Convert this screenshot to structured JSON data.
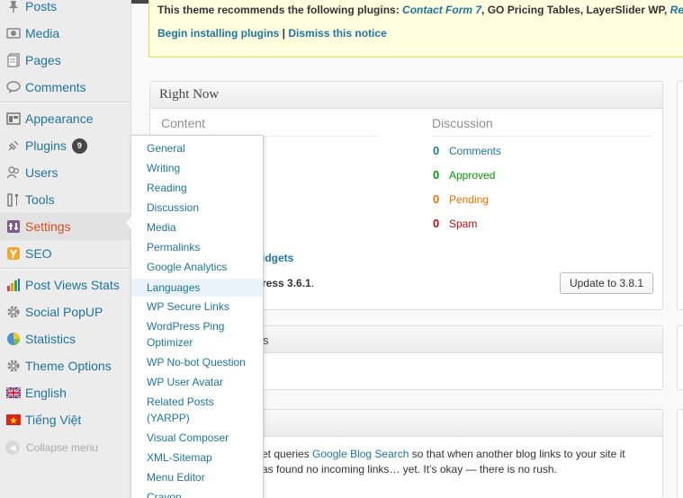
{
  "sidebar": {
    "items": [
      {
        "label": "Posts",
        "icon": "pushpin-icon"
      },
      {
        "label": "Media",
        "icon": "media-icon"
      },
      {
        "label": "Pages",
        "icon": "pages-icon"
      },
      {
        "label": "Comments",
        "icon": "comment-bubble-icon"
      },
      {
        "label": "Appearance",
        "icon": "appearance-icon"
      },
      {
        "label": "Plugins",
        "icon": "plug-icon",
        "badge": "9"
      },
      {
        "label": "Users",
        "icon": "users-icon"
      },
      {
        "label": "Tools",
        "icon": "tools-icon"
      },
      {
        "label": "Settings",
        "icon": "settings-icon",
        "current": true
      },
      {
        "label": "SEO",
        "icon": "seo-icon"
      },
      {
        "label": "Post Views Stats",
        "icon": "bar-chart-icon"
      },
      {
        "label": "Social PopUP",
        "icon": "gear-icon"
      },
      {
        "label": "Statistics",
        "icon": "pie-chart-icon"
      },
      {
        "label": "Theme Options",
        "icon": "gear-icon"
      },
      {
        "label": "English",
        "icon": "uk-flag-icon"
      },
      {
        "label": "Tiếng Việt",
        "icon": "vietnam-flag-icon"
      }
    ],
    "collapse_label": "Collapse menu"
  },
  "notice": {
    "text_prefix": "This theme recommends the following plugins: ",
    "plugin_link": "Contact Form 7",
    "text_rest": ", GO Pricing Tables, LayerSlider WP, ",
    "plugin_link_2": "Rec",
    "begin_link": "Begin installing plugins",
    "separator": " | ",
    "dismiss_link": "Dismiss this notice"
  },
  "right_now": {
    "title": "Right Now",
    "content_heading": "Content",
    "discussion_heading": "Discussion",
    "discussion_rows": [
      {
        "count": "0",
        "label": "Comments",
        "color": "#21759b"
      },
      {
        "count": "0",
        "label": "Approved",
        "color": "#009900"
      },
      {
        "count": "0",
        "label": "Pending",
        "color": "#e66f00"
      },
      {
        "count": "0",
        "label": "Spam",
        "color": "#bc0b0b"
      }
    ],
    "widgets_fragment": "idgets",
    "version_fragment": "ress 3.6.1",
    "version_period": ".",
    "update_button": "Update to 3.8.1"
  },
  "box2": {
    "title_fragment": "s"
  },
  "box3": {
    "line1_prefix": "et queries ",
    "line1_link": "Google Blog Search",
    "line1_suffix": " so that when another blog links to your site it",
    "line2": "as found no incoming links… yet. It’s okay — there is no rush."
  },
  "flyout": {
    "items": [
      "General",
      "Writing",
      "Reading",
      "Discussion",
      "Media",
      "Permalinks",
      "Google Analytics",
      "Languages",
      "WP Secure Links",
      "WordPress Ping\nOptimizer",
      "WP No-bot Question",
      "WP User Avatar",
      "Related Posts\n(YARPP)",
      "Visual Composer",
      "XML-Sitemap",
      "Menu Editor",
      "Crayon"
    ],
    "hovered": "Languages"
  },
  "colors": {
    "link": "#21759b",
    "current": "#d54e21",
    "notice_bg": "#ffffe0"
  }
}
